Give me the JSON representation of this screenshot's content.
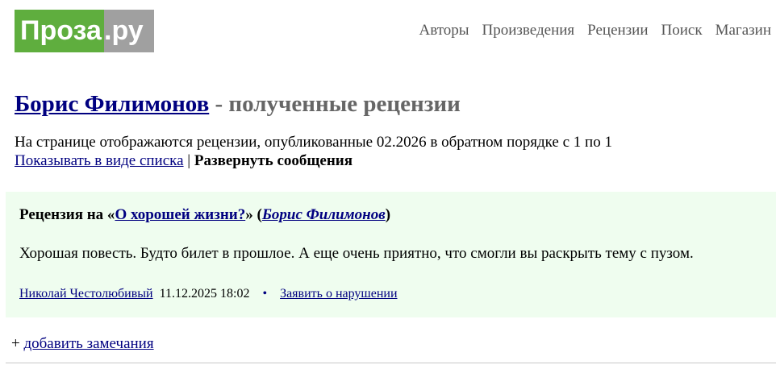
{
  "logo": {
    "part1": "Проза",
    "part2": ".ру"
  },
  "nav": [
    {
      "label": "Авторы"
    },
    {
      "label": "Произведения"
    },
    {
      "label": "Рецензии"
    },
    {
      "label": "Поиск"
    },
    {
      "label": "Магазин"
    }
  ],
  "page": {
    "author_name": "Борис Филимонов",
    "title_suffix": " - полученные рецензии",
    "info_text": "На странице отображаются рецензии, опубликованные 02.2026 в обратном порядке с 1 по 1",
    "list_view_link": "Показывать в виде списка",
    "separator": " | ",
    "expand_label": "Развернуть сообщения"
  },
  "review": {
    "prefix": "Рецензия на «",
    "work_title": "О хорошей жизни?",
    "mid": "» (",
    "work_author": "Борис Филимонов",
    "suffix": ")",
    "text": "Хорошая повесть. Будто билет в прошлое. А еще очень приятно, что смогли вы раскрыть тему с пузом.",
    "reviewer": "Николай Честолюбивый",
    "date": "11.12.2025 18:02",
    "dot": "•",
    "report_link": "Заявить о нарушении"
  },
  "footer": {
    "plus": "+ ",
    "add_comments_link": "добавить замечания"
  },
  "colors": {
    "logo_green": "#5fae3e",
    "logo_gray": "#a0a0a0",
    "link": "#000080",
    "review_bg": "#effdef"
  }
}
